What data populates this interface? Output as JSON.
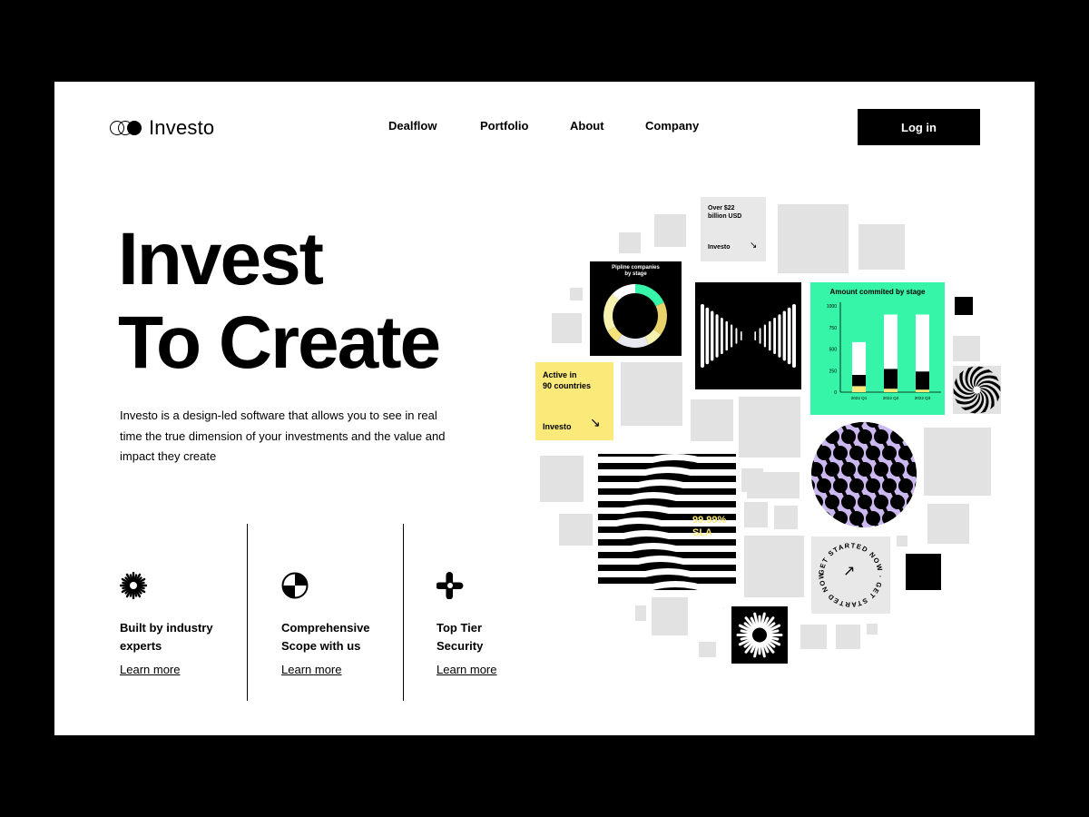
{
  "brand": {
    "name": "Investo"
  },
  "nav": {
    "items": [
      "Dealflow",
      "Portfolio",
      "About",
      "Company"
    ],
    "login_label": "Log in"
  },
  "hero": {
    "title_line1": "Invest",
    "title_line2": "To Create",
    "description": "Investo is a design-led software that allows you to see in real time the true dimension of your investments and the value and impact they create"
  },
  "features": [
    {
      "title_line1": "Built by industry",
      "title_line2": "experts",
      "link": "Learn more",
      "icon": "sunburst-icon"
    },
    {
      "title_line1": "Comprehensive",
      "title_line2": "Scope with us",
      "link": "Learn more",
      "icon": "quartered-circle-icon"
    },
    {
      "title_line1": "Top Tier",
      "title_line2": "Security",
      "link": "Learn more",
      "icon": "cross-loop-icon"
    }
  ],
  "cards": {
    "over": {
      "line1": "Over $22",
      "line2": "billion USD",
      "brand": "Investo"
    },
    "active": {
      "line1": "Active in",
      "line2": "90 countries",
      "brand": "Investo"
    },
    "sla": {
      "value": "99.99%",
      "label": "SLA"
    },
    "donut": {
      "title_line1": "Pipline companies",
      "title_line2": "by stage"
    },
    "cta": {
      "circular_text": "GET STARTED NOW · GET STARTED NOW · "
    }
  },
  "colors": {
    "accent_green": "#36f5a8",
    "accent_yellow": "#fbe97a",
    "accent_lavender": "#cbb8f0",
    "placeholder_gray": "#e2e2e2"
  },
  "chart_data": {
    "type": "bar",
    "title": "Amount commited by stage",
    "categories": [
      "2022 Q1",
      "2022 Q2",
      "2022 Q3"
    ],
    "y_ticks": [
      "0",
      "250",
      "500",
      "750",
      "1000"
    ],
    "ylim": [
      0,
      1000
    ],
    "series": [
      {
        "values": [
          70,
          40,
          30
        ],
        "color": "#fbe97a"
      },
      {
        "values": [
          130,
          230,
          210
        ],
        "color": "#000000"
      },
      {
        "values": [
          380,
          630,
          660
        ],
        "color": "#ffffff"
      }
    ]
  }
}
